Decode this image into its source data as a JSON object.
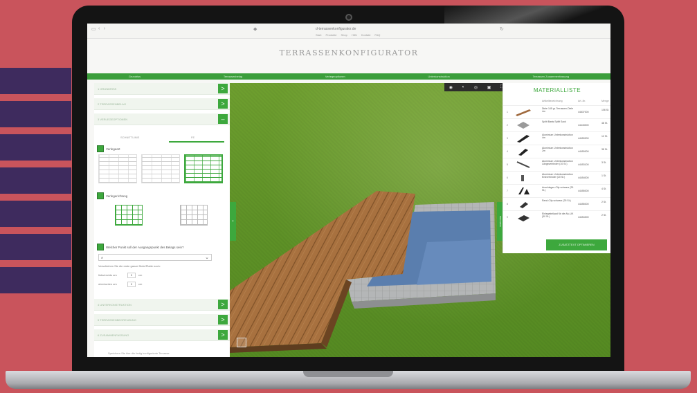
{
  "browser": {
    "url": "d-terrassenkonfigurator.de",
    "links": [
      "Start",
      "Produkte",
      "Shop",
      "Hilfe",
      "Kontakt",
      "FAQ"
    ]
  },
  "site": {
    "title": "TERRASSENKONFIGURATOR"
  },
  "nav": [
    "Grundriss",
    "Terrassenbelag",
    "Verlegeoptionen",
    "Unterkonstruktion",
    "Terrassen Zusammenfassung"
  ],
  "sidebar": {
    "steps_top": [
      {
        "label": "1  GRUNDRISS",
        "button": ">"
      },
      {
        "label": "2  TERRASSENBELAG",
        "button": ">"
      },
      {
        "label": "3  VERLEGEOPTIONEN",
        "button": "–"
      }
    ],
    "tabs": [
      "SCHNITTLINIE",
      "FE"
    ],
    "section_pattern": {
      "number": "3.1",
      "label": "Verlegeart"
    },
    "section_direction": {
      "number": "3.2",
      "label": "Verlegerichtung"
    },
    "section_start": {
      "number": "3.3",
      "label": "Welcher Punkt soll der Ausgangspunkt des Belags sein?"
    },
    "select_value": "A",
    "offset_note": "Verschieben Sie die erste ganze Diele/Platte noch:",
    "offset_right": {
      "label": "links/rechts um",
      "value": "0",
      "unit": "cm"
    },
    "offset_down": {
      "label": "oben/unten um",
      "value": "0",
      "unit": "cm"
    },
    "steps_bottom": [
      {
        "label": "4  UNTERKONSTRUKTION",
        "button": ">"
      },
      {
        "label": "5  TERRASSENBEGRENZUNG",
        "button": ">"
      },
      {
        "label": "6  ZUSAMMENFASSUNG",
        "button": ">"
      }
    ],
    "footer_note": "Speichern Sie hier die fertig konfigurierte Terrasse"
  },
  "viewport": {
    "toolbar_icons": [
      "camera-icon",
      "eye-icon",
      "view-icon",
      "save-icon",
      "fullscreen-icon"
    ],
    "left_handle": "‹",
    "right_handle": "Materialliste"
  },
  "materials": {
    "title": "MATERIALLISTE",
    "headers": [
      "Artikelbezeichnung",
      "Art.-Nr.",
      "Menge"
    ],
    "rows": [
      {
        "num": "1",
        "name": "Diele 145 gr. Terrassen-Diele 4m",
        "art": "44837000",
        "qty": "106 St.",
        "color": "#a06a3e"
      },
      {
        "num": "2",
        "name": "Splitt Basis Splitt Sack",
        "art": "44443000",
        "qty": "48 St.",
        "color": "#9a9a9a"
      },
      {
        "num": "3",
        "name": "Aluminium Unterkonstruktion 4m",
        "art": "44450000",
        "qty": "12 St.",
        "color": "#222222"
      },
      {
        "num": "4",
        "name": "Aluminium Unterkonstruktion 2m",
        "art": "44450000",
        "qty": "38 St.",
        "color": "#222222"
      },
      {
        "num": "5",
        "name": "Aluminium Unterkonstruktion Längsverbinder (10 St.)",
        "art": "44453100",
        "qty": "3 St.",
        "color": "#444444"
      },
      {
        "num": "6",
        "name": "Aluminium Unterkonstruktion Endverbinder (20 St.)",
        "art": "44454000",
        "qty": "1 St.",
        "color": "#555555"
      },
      {
        "num": "7",
        "name": "Anschlagen-Clip schwarz (25 St.)",
        "art": "44455000",
        "qty": "4 St.",
        "color": "#222222"
      },
      {
        "num": "8",
        "name": "Rand-Clip schwarz (25 St.)",
        "art": "44455000",
        "qty": "2 St.",
        "color": "#333333"
      },
      {
        "num": "9",
        "name": "Einlegekeilpad für die Alu-UK (30 St.)",
        "art": "44454300",
        "qty": "2 St.",
        "color": "#333333"
      }
    ],
    "button": "ZUSATZTEXT OPTIMIEREN"
  },
  "colors": {
    "accent": "#3da83d",
    "wood": "#a8713f",
    "pool": "#5a7eae",
    "frame": "#b7b9ba",
    "grass": "#5f9227"
  }
}
